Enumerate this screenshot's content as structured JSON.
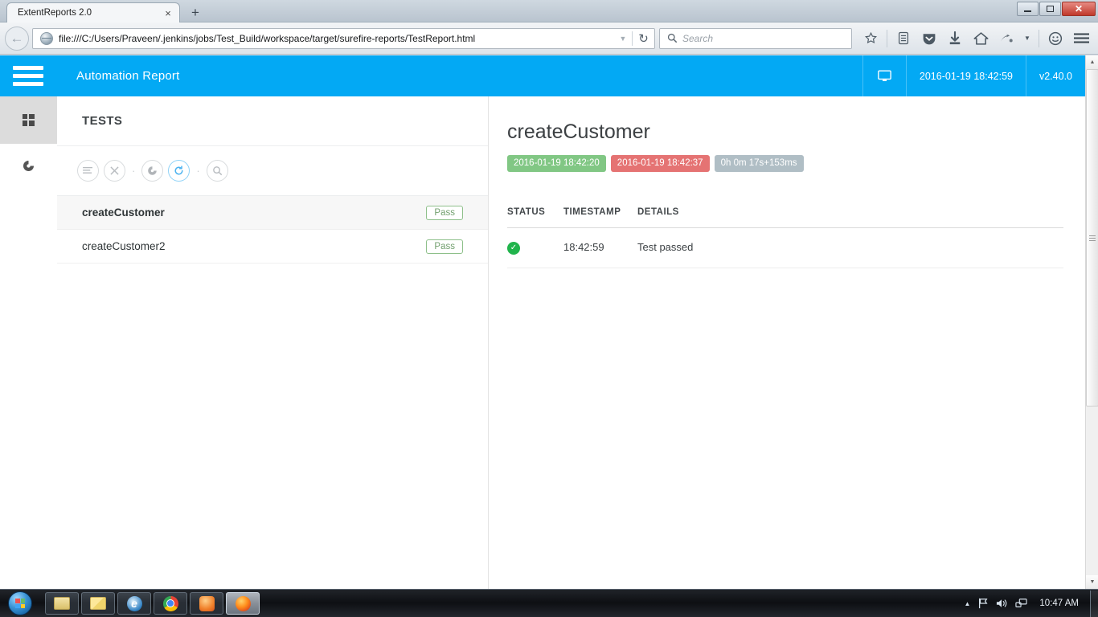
{
  "browser": {
    "tab_title": "ExtentReports 2.0",
    "tab_close": "×",
    "new_tab": "+",
    "url": "file:///C:/Users/Praveen/.jenkins/jobs/Test_Build/workspace/target/surefire-reports/TestReport.html",
    "search_placeholder": "Search",
    "window_controls": {
      "minimize": "—",
      "restore": "❐",
      "close": "✕"
    },
    "toolbar_icons": [
      "bookmark-star-icon",
      "reading-list-icon",
      "pocket-icon",
      "downloads-icon",
      "home-icon",
      "sync-icon",
      "dropdown-icon",
      "feedback-smiley-icon",
      "menu-hamburger-icon"
    ]
  },
  "report": {
    "brand": "Automation Report",
    "header_timestamp": "2016-01-19 18:42:59",
    "version": "v2.40.0",
    "monitor_icon": "monitor-icon",
    "rail": [
      {
        "name": "dashboard",
        "icon": "grid-dashboard-icon",
        "active": true
      },
      {
        "name": "charts",
        "icon": "pie-chart-icon",
        "active": false
      }
    ],
    "tests_panel": {
      "title": "TESTS",
      "filters": [
        {
          "name": "list",
          "icon": "list-lines-icon",
          "active": false
        },
        {
          "name": "fail",
          "icon": "close-x-icon",
          "active": false
        },
        {
          "name": "skip",
          "icon": "gauge-icon",
          "active": false
        },
        {
          "name": "refresh",
          "icon": "refresh-icon",
          "active": true
        },
        {
          "name": "search",
          "icon": "search-icon",
          "active": false
        }
      ],
      "tests": [
        {
          "name": "createCustomer",
          "status": "Pass",
          "selected": true
        },
        {
          "name": "createCustomer2",
          "status": "Pass",
          "selected": false
        }
      ]
    },
    "detail": {
      "title": "createCustomer",
      "start_time": "2016-01-19 18:42:20",
      "end_time": "2016-01-19 18:42:37",
      "duration": "0h 0m 17s+153ms",
      "columns": [
        "STATUS",
        "TIMESTAMP",
        "DETAILS"
      ],
      "rows": [
        {
          "status_icon": "check-circle-icon",
          "timestamp": "18:42:59",
          "details": "Test passed"
        }
      ]
    },
    "colors": {
      "accent": "#03a9f4",
      "pass": "#81c784",
      "fail": "#e57373",
      "duration": "#b0bec5",
      "check": "#21b44c"
    }
  },
  "taskbar": {
    "start": "start-orb",
    "apps": [
      {
        "name": "file-explorer",
        "icon": "folder-icon",
        "active": false
      },
      {
        "name": "sticky-app",
        "icon": "stack-icon",
        "active": false
      },
      {
        "name": "internet-explorer",
        "icon": "ie-icon",
        "active": false
      },
      {
        "name": "google-chrome",
        "icon": "chrome-icon",
        "active": false
      },
      {
        "name": "uc-browser",
        "icon": "uc-icon",
        "active": false
      },
      {
        "name": "firefox",
        "icon": "firefox-icon",
        "active": true
      }
    ],
    "tray": {
      "expand": "▲",
      "action_center": "flag-icon",
      "volume": "speaker-icon",
      "network": "network-icon",
      "clock": "10:47 AM"
    }
  }
}
